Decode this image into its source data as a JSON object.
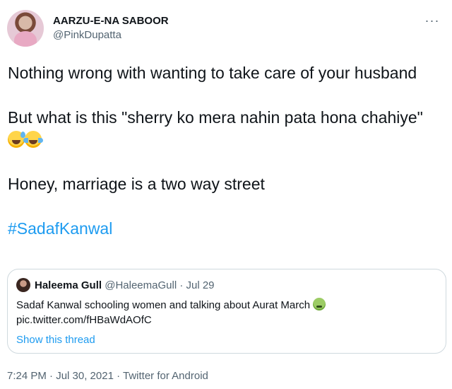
{
  "author": {
    "display_name": "AARZU-E-NA SABOOR",
    "handle": "@PinkDupatta"
  },
  "more_icon": "more-horizontal-icon",
  "tweet": {
    "line1": "Nothing wrong with wanting to take care of your husband",
    "line2": "But what is this \"sherry ko mera nahin pata hona chahiye\"",
    "emojis": [
      "grinning-sweat-emoji",
      "tears-of-joy-emoji"
    ],
    "line3": "Honey, marriage is a two way street",
    "hashtag": "#SadafKanwal"
  },
  "quote": {
    "name": "Haleema Gull",
    "handle": "@HaleemaGull",
    "separator": "·",
    "date": "Jul 29",
    "text": "Sadaf Kanwal schooling women and talking about Aurat March",
    "emoji": "nauseated-face-emoji",
    "link": "pic.twitter.com/fHBaWdAOfC",
    "show_thread": "Show this thread"
  },
  "footer": {
    "meta": "7:24 PM · Jul 30, 2021 · Twitter for Android"
  },
  "colors": {
    "accent": "#1d9bf0",
    "text": "#0f1419",
    "muted": "#536471",
    "border": "#cfd9de"
  }
}
